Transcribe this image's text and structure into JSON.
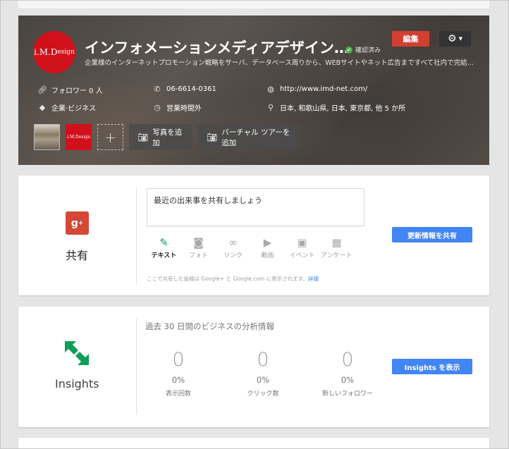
{
  "hero": {
    "logo_text": "i.M.D",
    "logo_subtext": "esign",
    "title": "インフォメーションメディアデザイン…",
    "verified_label": "確認済み",
    "description": "企業様のインターネットプロモーション戦略をサーバ、データベース周りから、WEBサイトやネット広告まですべて社内で完結できるトー…",
    "edit_label": "編集",
    "info": {
      "followers": "フォロワー 0 人",
      "phone": "06-6614-0361",
      "website": "http://www.imd-net.com/",
      "category": "企業·ビジネス",
      "hours": "営業時間外",
      "address": "日本, 和歌山県, 日本, 東京都, 他 5 か所"
    },
    "add_photo_label": "写真を追加",
    "add_tour_label": "バーチャル ツアーを追加",
    "thumb2_text": "i.M.Design"
  },
  "share_card": {
    "label": "共有",
    "input_placeholder": "最近の出来事を共有しましょう",
    "tabs": [
      {
        "label": "テキスト",
        "icon": "pencil-icon"
      },
      {
        "label": "フォト",
        "icon": "camera-icon"
      },
      {
        "label": "リンク",
        "icon": "link-icon"
      },
      {
        "label": "動画",
        "icon": "video-icon"
      },
      {
        "label": "イベント",
        "icon": "event-icon"
      },
      {
        "label": "アンケート",
        "icon": "poll-icon"
      }
    ],
    "note": "ここで共有した投稿は Google+ と Google.com に表示されます。",
    "note_link": "詳細",
    "button_label": "更新情報を共有"
  },
  "insights_card": {
    "label": "Insights",
    "title": "過去 30 日間のビジネスの分析情報",
    "stats": [
      {
        "value": "0",
        "percent": "0%",
        "label": "表示回数"
      },
      {
        "value": "0",
        "percent": "0%",
        "label": "クリック数"
      },
      {
        "value": "0",
        "percent": "0%",
        "label": "新しいフォロワー"
      }
    ],
    "button_label": "Insights を表示"
  }
}
